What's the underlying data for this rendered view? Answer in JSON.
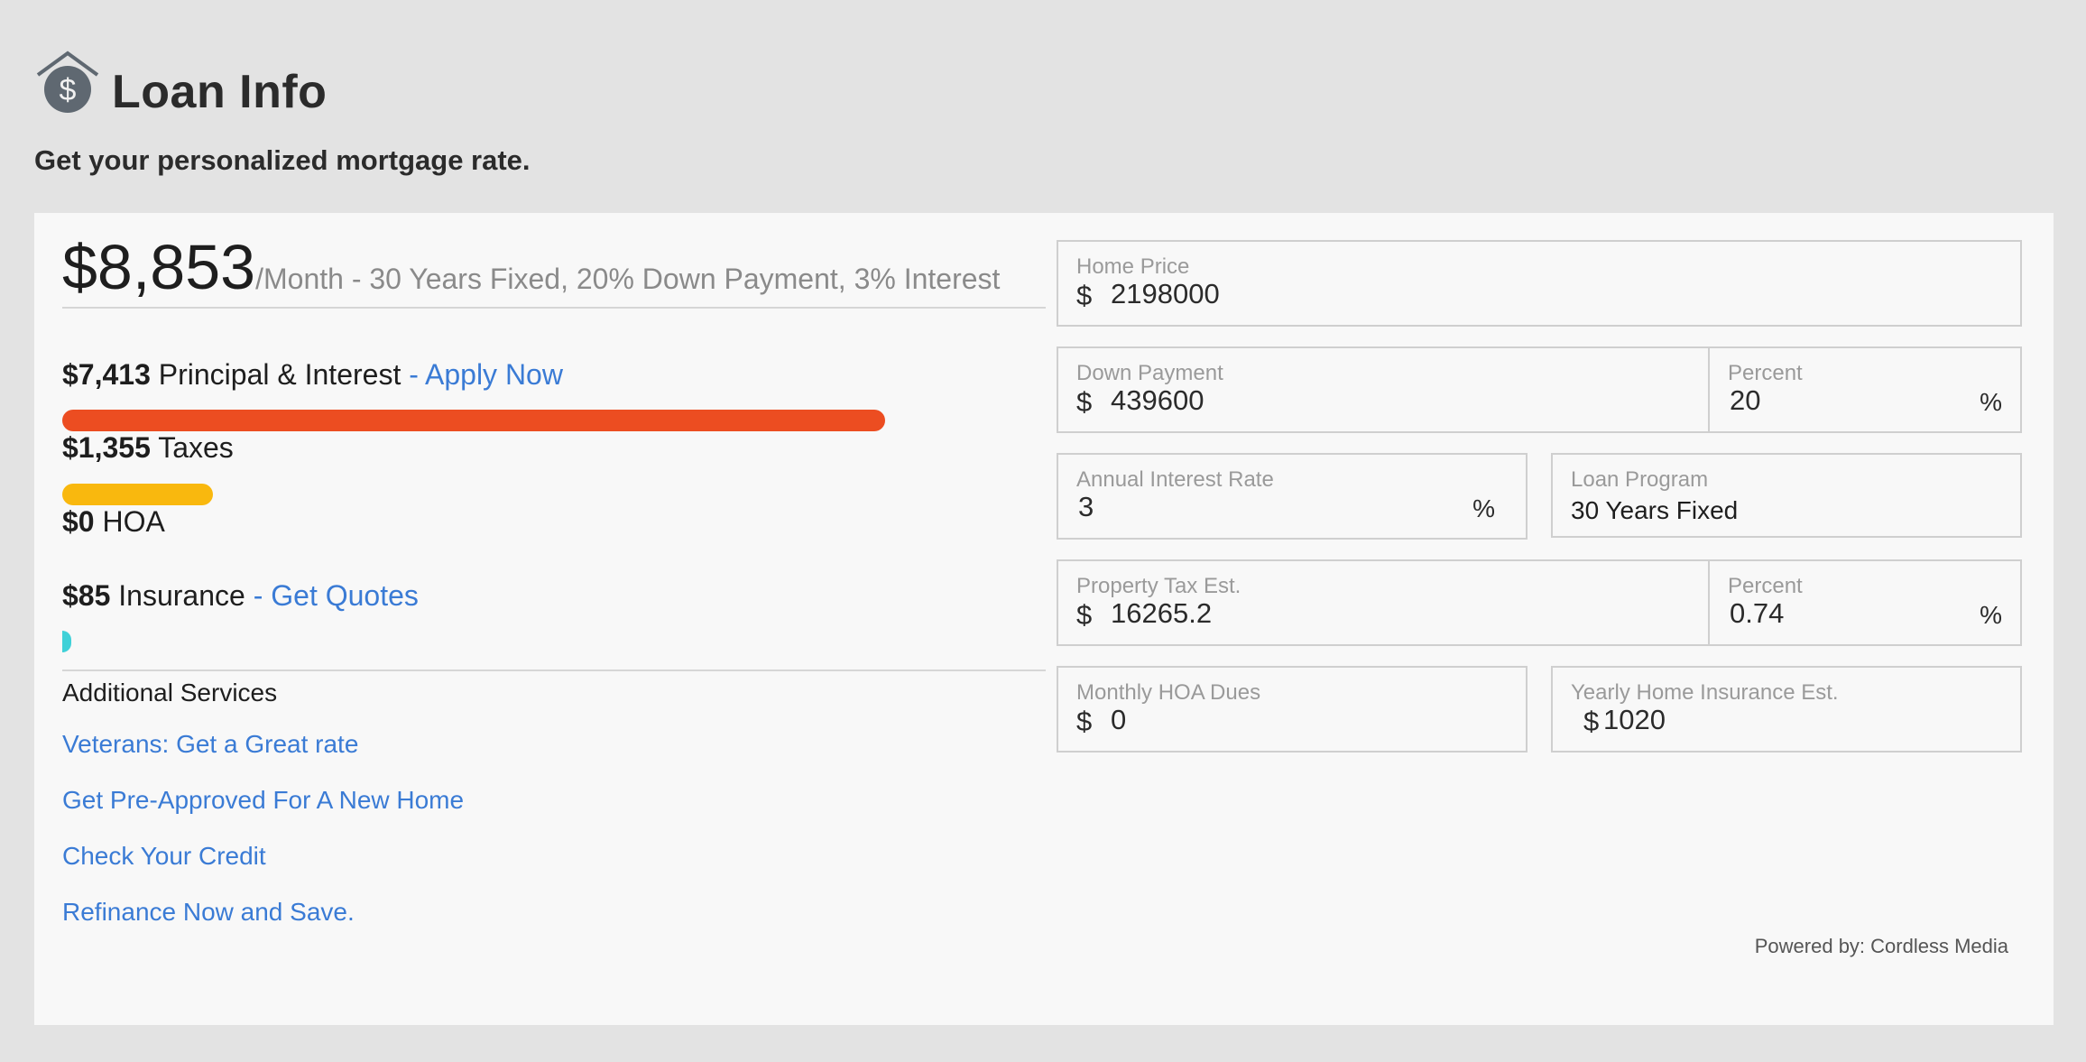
{
  "header": {
    "title": "Loan Info",
    "subtitle": "Get your personalized mortgage rate."
  },
  "summary": {
    "monthly_amount": "$8,853",
    "description": "/Month - 30 Years Fixed, 20% Down Payment, 3% Interest"
  },
  "breakdown": {
    "principal": {
      "amount": "$7,413",
      "label": "Principal & Interest",
      "link": "- Apply Now",
      "bar_fraction": 0.837,
      "bar_color": "#ec4d21"
    },
    "taxes": {
      "amount": "$1,355",
      "label": "Taxes",
      "bar_fraction": 0.153,
      "bar_color": "#f9b80e"
    },
    "hoa": {
      "amount": "$0",
      "label": "HOA"
    },
    "insurance": {
      "amount": "$85",
      "label": "Insurance",
      "link": "- Get Quotes",
      "bar_fraction": 0.0096,
      "bar_color": "#3fd1d8"
    }
  },
  "additional_services": {
    "heading": "Additional Services",
    "links": [
      "Veterans: Get a Great rate",
      "Get Pre-Approved For A New Home",
      "Check Your Credit",
      "Refinance Now and Save."
    ]
  },
  "form": {
    "home_price": {
      "label": "Home Price",
      "currency": "$",
      "value": "2198000"
    },
    "down_payment": {
      "label": "Down Payment",
      "currency": "$",
      "value": "439600"
    },
    "down_percent": {
      "label": "Percent",
      "value": "20",
      "unit": "%"
    },
    "interest_rate": {
      "label": "Annual Interest Rate",
      "value": "3",
      "unit": "%"
    },
    "loan_program": {
      "label": "Loan Program",
      "value": "30 Years Fixed"
    },
    "property_tax": {
      "label": "Property Tax Est.",
      "currency": "$",
      "value": "16265.2"
    },
    "tax_percent": {
      "label": "Percent",
      "value": "0.74",
      "unit": "%"
    },
    "hoa_dues": {
      "label": "Monthly HOA Dues",
      "currency": "$",
      "value": "0"
    },
    "home_insurance": {
      "label": "Yearly Home Insurance Est.",
      "currency": "$",
      "value": "1020"
    }
  },
  "footer": {
    "powered_by": "Powered by: Cordless Media"
  },
  "colors": {
    "accent_link": "#3a7bd5",
    "page_bg": "#e3e3e3",
    "panel_bg": "#f8f8f8"
  }
}
